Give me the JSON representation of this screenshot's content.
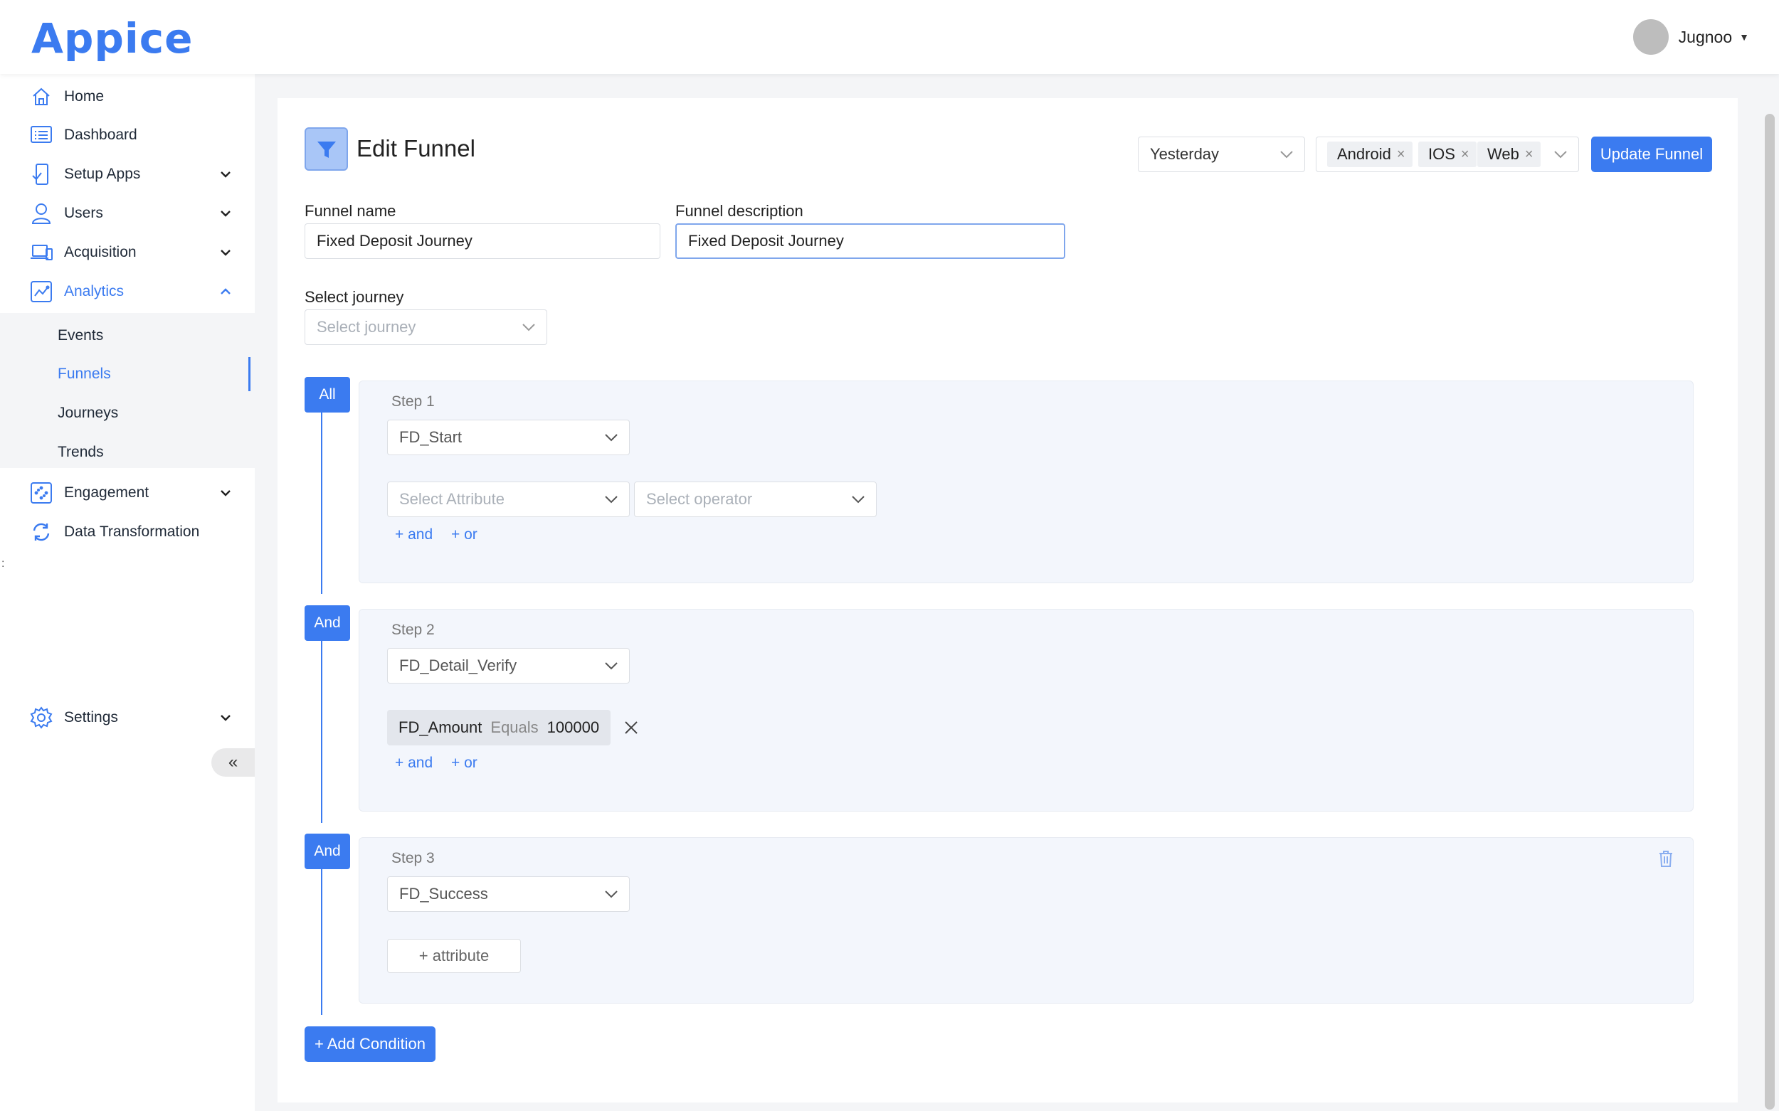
{
  "brand": {
    "logo_text": "Appice",
    "accent": "#3b7bf0"
  },
  "user": {
    "name": "Jugnoo"
  },
  "sidebar": {
    "items": [
      {
        "label": "Home",
        "icon": "home-icon"
      },
      {
        "label": "Dashboard",
        "icon": "dashboard-icon"
      },
      {
        "label": "Setup Apps",
        "icon": "setup-apps-icon"
      },
      {
        "label": "Users",
        "icon": "user-icon"
      },
      {
        "label": "Acquisition",
        "icon": "acquisition-icon"
      },
      {
        "label": "Analytics",
        "icon": "analytics-icon"
      },
      {
        "label": "Engagement",
        "icon": "engagement-icon"
      },
      {
        "label": "Data Transformation",
        "icon": "sync-icon"
      },
      {
        "label": "Settings",
        "icon": "gear-icon"
      }
    ],
    "analytics_sub": [
      {
        "label": "Events"
      },
      {
        "label": "Funnels"
      },
      {
        "label": "Journeys"
      },
      {
        "label": "Trends"
      }
    ],
    "active_item": "Analytics",
    "active_sub": "Funnels",
    "collapse_label": "«"
  },
  "page": {
    "title": "Edit Funnel",
    "date_range": "Yesterday",
    "platforms": [
      "Android",
      "IOS",
      "Web"
    ],
    "update_button": "Update Funnel",
    "funnel_name_label": "Funnel name",
    "funnel_name_value": "Fixed Deposit Journey",
    "funnel_description_label": "Funnel description",
    "funnel_description_value": "Fixed Deposit Journey",
    "select_journey_label": "Select journey",
    "select_journey_placeholder": "Select journey"
  },
  "steps": [
    {
      "connector": "All",
      "label": "Step 1",
      "event": "FD_Start",
      "attribute_placeholder": "Select Attribute",
      "operator_placeholder": "Select operator",
      "and_link": "+ and",
      "or_link": "+ or"
    },
    {
      "connector": "And",
      "label": "Step 2",
      "event": "FD_Detail_Verify",
      "condition": {
        "attribute": "FD_Amount",
        "operator": "Equals",
        "value": "100000"
      },
      "and_link": "+ and",
      "or_link": "+ or"
    },
    {
      "connector": "And",
      "label": "Step 3",
      "event": "FD_Success",
      "add_attribute": "+ attribute"
    }
  ],
  "add_condition": "+ Add Condition"
}
